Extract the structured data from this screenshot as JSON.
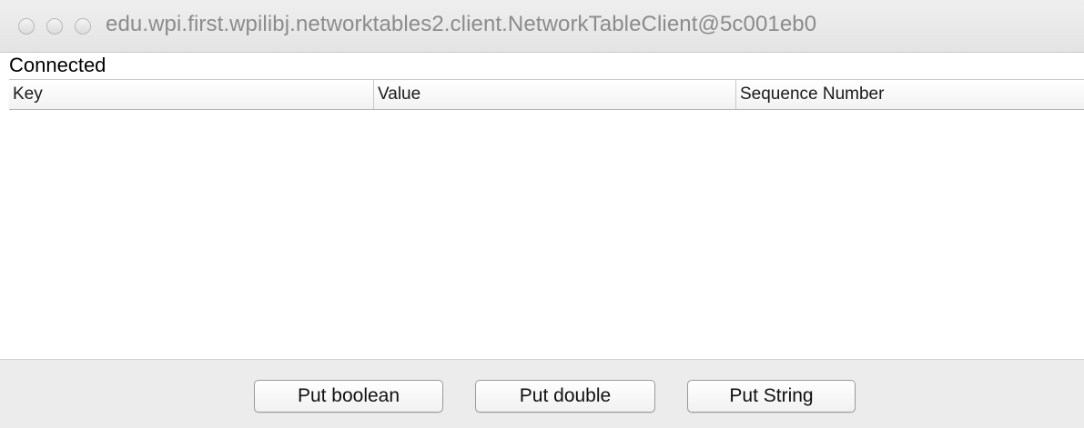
{
  "window": {
    "title": "edu.wpi.first.wpilibj.networktables2.client.NetworkTableClient@5c001eb0"
  },
  "status": {
    "text": "Connected"
  },
  "table": {
    "columns": [
      "Key",
      "Value",
      "Sequence Number"
    ],
    "rows": []
  },
  "buttons": {
    "put_boolean": "Put boolean",
    "put_double": "Put double",
    "put_string": "Put String"
  }
}
